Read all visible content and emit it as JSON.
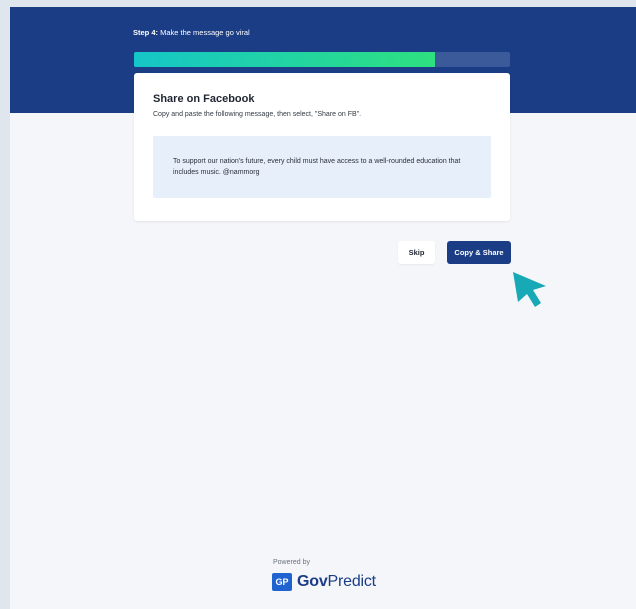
{
  "header": {
    "step_prefix": "Step 4:",
    "step_title": " Make the message go viral",
    "progress_fraction": 0.8
  },
  "card": {
    "title": "Share on Facebook",
    "instruction": "Copy and paste the following message, then select, \"Share on FB\".",
    "message": "To support our nation's future, every child must have access to a well-rounded education that includes music. @nammorg"
  },
  "actions": {
    "skip_label": "Skip",
    "share_label": "Copy & Share"
  },
  "footer": {
    "powered_by": "Powered by",
    "brand_badge": "GP",
    "brand_bold": "Gov",
    "brand_rest": "Predict"
  },
  "icons": {
    "cursor": "pointer-arrow-icon"
  },
  "colors": {
    "header_bg": "#1b3d86",
    "progress_start": "#15c6c8",
    "progress_end": "#2ee07f",
    "cursor": "#17a9b5",
    "brand_blue": "#1f63d1"
  }
}
